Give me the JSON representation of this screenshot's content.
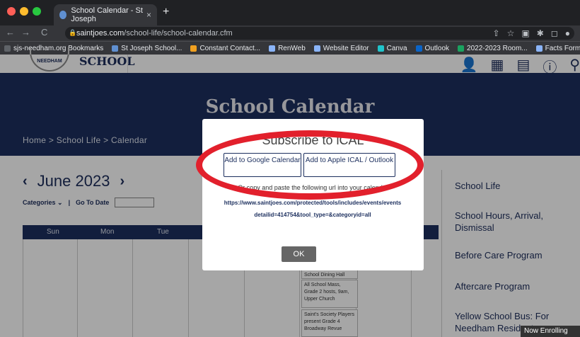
{
  "browser": {
    "tab_title": "School Calendar - St Joseph",
    "tab_close": "×",
    "new_tab": "+",
    "url_host": "saintjoes.com",
    "url_path": "/school-life/school-calendar.cfm",
    "nav": {
      "back": "←",
      "forward": "→",
      "reload": "C"
    },
    "extensions": [
      "⇧",
      "☆",
      "▣",
      "✱",
      "◻",
      "●"
    ],
    "bookmarks": [
      {
        "label": "sjs-needham.org Bookmarks",
        "color": "#5f6368"
      },
      {
        "label": "St Joseph School...",
        "color": "#5f8fd0"
      },
      {
        "label": "Constant Contact...",
        "color": "#f0a020"
      },
      {
        "label": "RenWeb",
        "color": "#8ab4f8"
      },
      {
        "label": "Website Editor",
        "color": "#8ab4f8"
      },
      {
        "label": "Canva",
        "color": "#20c4cb"
      },
      {
        "label": "Outlook",
        "color": "#0a64c8"
      },
      {
        "label": "2022-2023 Room...",
        "color": "#1aa260"
      },
      {
        "label": "Facts Forms",
        "color": "#8ab4f8"
      }
    ]
  },
  "site": {
    "logo_text": "SCHOOL",
    "logo_ring": "NEEDHAM",
    "header_icons": [
      "👤",
      "▦",
      "▤",
      "ⓘ",
      "⚲"
    ],
    "page_title": "School Calendar",
    "breadcrumb": "Home > School Life > Calendar"
  },
  "calendar": {
    "month_label": "June 2023",
    "prev": "‹",
    "next": "›",
    "categories_label": "Categories ⌄",
    "separator": "|",
    "go_to_date_label": "Go To Date",
    "weekdays": [
      "Sun",
      "Mon",
      "Tue"
    ],
    "events": [
      "School Dining Hall",
      "All School Mass, Grade 2 hosts, 9am, Upper Church",
      "Saint's Society Players present Grade 4 Broadway Revue"
    ]
  },
  "sidebar": {
    "items": [
      "School Life",
      "School Hours, Arrival, Dismissal",
      "Before Care Program",
      "Aftercare Program",
      "Yellow School Bus: For Needham Residents"
    ],
    "enroll_badge": "Now Enrolling"
  },
  "modal": {
    "title": "Subscribe to iCAL",
    "google_button": "Add to Google Calendar",
    "apple_button": "Add to Apple ICAL / Outlook",
    "instructions": "Or copy and paste the following url into your calendar",
    "ical_url": "https://www.saintjoes.com/protected/tools/includes/events/events detailid=414754&tool_type=&categoryid=all",
    "ok_button": "OK"
  },
  "colors": {
    "brand_navy": "#1c2f5e",
    "highlight_ring": "#e2202c"
  }
}
